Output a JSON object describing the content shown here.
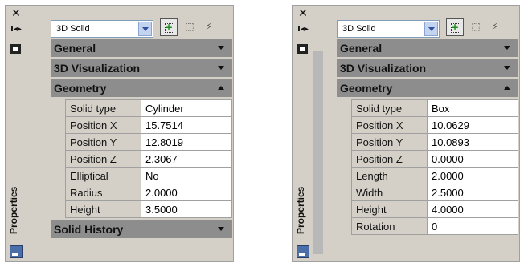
{
  "palettes": [
    {
      "strip_title": "Properties",
      "select_value": "3D Solid",
      "sections": {
        "general": "General",
        "visualization": "3D Visualization",
        "geometry": "Geometry",
        "history": "Solid History"
      },
      "rows": [
        {
          "k": "Solid type",
          "v": "Cylinder"
        },
        {
          "k": "Position X",
          "v": "15.7514"
        },
        {
          "k": "Position Y",
          "v": "12.8019"
        },
        {
          "k": "Position Z",
          "v": "2.3067"
        },
        {
          "k": "Elliptical",
          "v": "No"
        },
        {
          "k": "Radius",
          "v": "2.0000"
        },
        {
          "k": "Height",
          "v": "3.5000"
        }
      ]
    },
    {
      "strip_title": "Properties",
      "select_value": "3D Solid",
      "sections": {
        "general": "General",
        "visualization": "3D Visualization",
        "geometry": "Geometry"
      },
      "rows": [
        {
          "k": "Solid type",
          "v": "Box"
        },
        {
          "k": "Position X",
          "v": "10.0629"
        },
        {
          "k": "Position Y",
          "v": "10.0893"
        },
        {
          "k": "Position Z",
          "v": "0.0000"
        },
        {
          "k": "Length",
          "v": "2.0000"
        },
        {
          "k": "Width",
          "v": "2.5000"
        },
        {
          "k": "Height",
          "v": "4.0000"
        },
        {
          "k": "Rotation",
          "v": "0"
        }
      ]
    }
  ],
  "icons": [
    "close-icon",
    "autohide-arrows-icon",
    "toggle-description-icon",
    "dropdown-arrow-icon",
    "pickadd-icon",
    "select-objects-icon",
    "quick-select-icon",
    "chevron-down-icon",
    "chevron-up-icon",
    "palette-properties-icon"
  ]
}
